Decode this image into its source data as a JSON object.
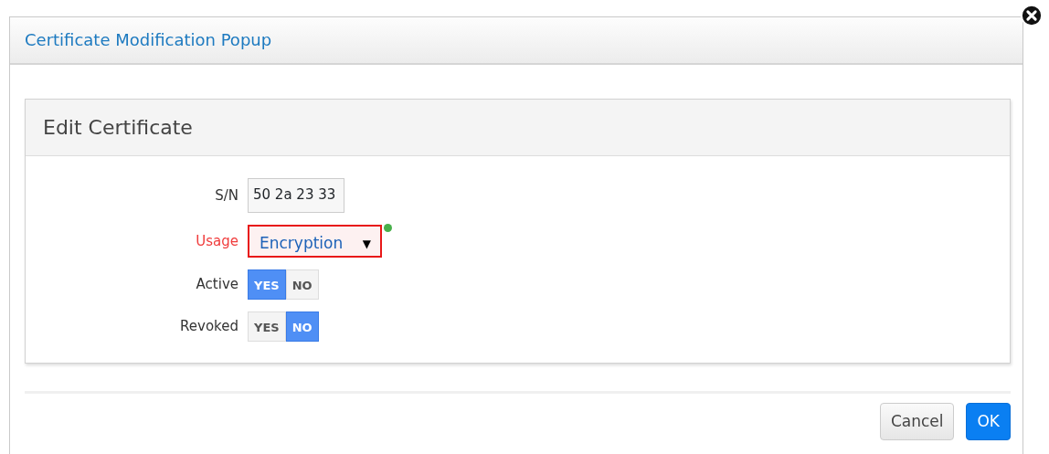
{
  "popup": {
    "title": "Certificate Modification Popup"
  },
  "panel": {
    "title": "Edit Certificate"
  },
  "fields": [
    {
      "kind": "text",
      "label": "S/N",
      "value": "50 2a 23 33",
      "invalid": false
    },
    {
      "kind": "select",
      "label": "Usage",
      "value": "Encryption",
      "invalid": true,
      "caret": "▼"
    },
    {
      "kind": "toggle",
      "label": "Active",
      "options": [
        {
          "label": "YES",
          "selected": true
        },
        {
          "label": "NO",
          "selected": false
        }
      ]
    },
    {
      "kind": "toggle",
      "label": "Revoked",
      "options": [
        {
          "label": "YES",
          "selected": false
        },
        {
          "label": "NO",
          "selected": true
        }
      ]
    }
  ],
  "buttons": [
    {
      "label": "Cancel",
      "kind": "secondary"
    },
    {
      "label": "OK",
      "kind": "primary"
    }
  ]
}
